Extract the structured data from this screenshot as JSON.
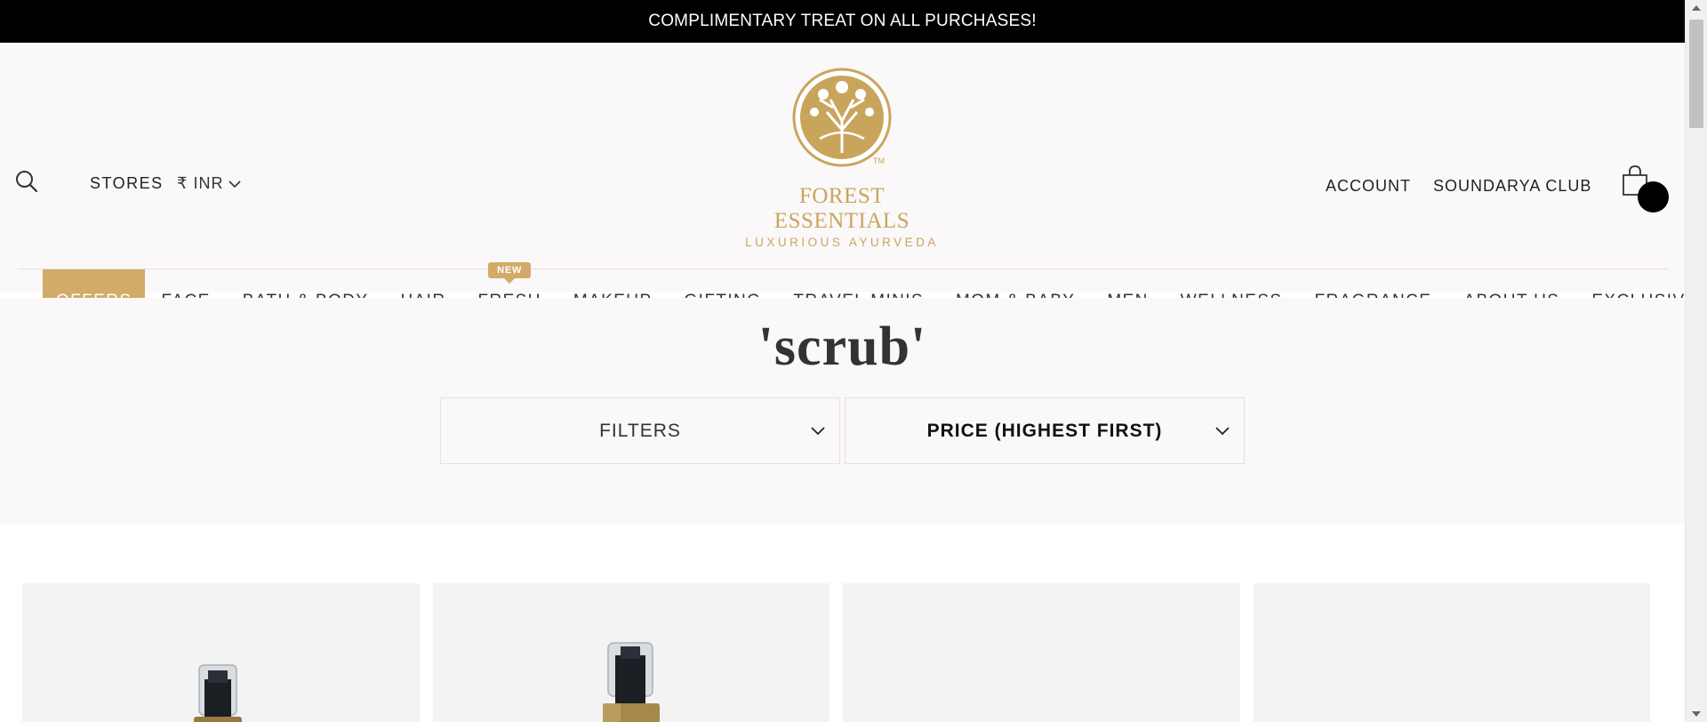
{
  "announcement": "COMPLIMENTARY TREAT ON ALL PURCHASES!",
  "header": {
    "stores": "STORES",
    "currency": "₹ INR",
    "account": "ACCOUNT",
    "club": "SOUNDARYA CLUB",
    "logo": {
      "brand": "FOREST ESSENTIALS",
      "tagline": "LUXURIOUS AYURVEDA",
      "tm": "TM"
    }
  },
  "nav": {
    "items": [
      {
        "label": "OFFERS"
      },
      {
        "label": "FACE"
      },
      {
        "label": "BATH & BODY"
      },
      {
        "label": "HAIR"
      },
      {
        "label": "FRESH",
        "badge": "NEW"
      },
      {
        "label": "MAKEUP"
      },
      {
        "label": "GIFTING"
      },
      {
        "label": "TRAVEL MINIS"
      },
      {
        "label": "MOM & BABY"
      },
      {
        "label": "MEN"
      },
      {
        "label": "WELLNESS"
      },
      {
        "label": "FRAGRANCE"
      },
      {
        "label": "ABOUT US"
      },
      {
        "label": "EXCLUSIVES!"
      }
    ]
  },
  "search": {
    "query_title": "'scrub'",
    "filters_label": "FILTERS",
    "sort_label": "PRICE (HIGHEST FIRST)"
  },
  "colors": {
    "gold": "#d2ab68",
    "logo_gold": "#c9a55c",
    "announcement_bg": "#000000",
    "header_bg": "#faf8f8",
    "card_bg": "#f3f3f3"
  },
  "icons": {
    "search": "search-icon",
    "currency_chevron": "chevron-down-icon",
    "cart": "shopping-bag-icon",
    "filter_chevron": "chevron-down-icon"
  }
}
